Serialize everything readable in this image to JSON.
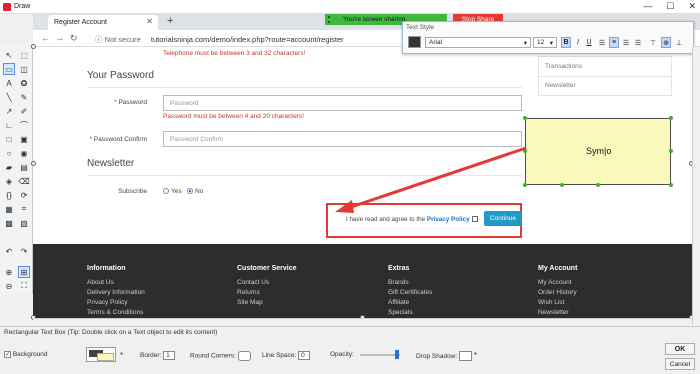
{
  "app": {
    "title": "Draw",
    "min": "—",
    "max": "☐",
    "close": "✕"
  },
  "browser": {
    "tab_title": "Register Account",
    "tab_close": "✕",
    "new_tab": "+",
    "share_text": "You're screen sharing",
    "stop_share": "Stop Share",
    "not_secure": "ⓘ Not secure",
    "url": "tutorialsninja.com/demo/index.php?route=account/register"
  },
  "form": {
    "telephone_error": "Telephone must be between 3 and 32 characters!",
    "password_section": "Your Password",
    "password_label": "Password",
    "password_placeholder": "Password",
    "password_error": "Password must be between 4 and 20 characters!",
    "confirm_label": "Password Confirm",
    "confirm_placeholder": "Password Confirm",
    "newsletter_section": "Newsletter",
    "subscribe_label": "Subscribe",
    "radio_yes": "Yes",
    "radio_no": "No",
    "subscribe_value": "No",
    "agree_text": "I have read and agree to the ",
    "privacy_link": "Privacy Policy",
    "continue": "Continue"
  },
  "right_menu": [
    "Transactions",
    "Newsletter"
  ],
  "footer": {
    "columns": [
      {
        "head": "Information",
        "items": [
          "About Us",
          "Delivery Information",
          "Privacy Policy",
          "Terms & Conditions"
        ]
      },
      {
        "head": "Customer Service",
        "items": [
          "Contact Us",
          "Returns",
          "Site Map"
        ]
      },
      {
        "head": "Extras",
        "items": [
          "Brands",
          "Gift Certificates",
          "Affiliate",
          "Specials"
        ]
      },
      {
        "head": "My Account",
        "items": [
          "My Account",
          "Order History",
          "Wish List",
          "Newsletter"
        ]
      }
    ]
  },
  "text_style": {
    "title": "Text Style",
    "font": "Arial",
    "size": "12",
    "bold": "B",
    "italic": "I",
    "underline": "U"
  },
  "note": {
    "text": "Sym|o"
  },
  "status_hint": "Rectangular Text Box (Tip: Double click on a Text object to edit its content)",
  "props": {
    "background_label": "Background",
    "border_label": "Border:",
    "border_value": "1",
    "round_label": "Round Corners:",
    "linespace_label": "Line Space:",
    "linespace_value": "0",
    "opacity_label": "Opacity:",
    "shadow_label": "Drop Shadow:",
    "ok": "OK",
    "cancel": "Cancel"
  },
  "colors": {
    "accent": "#229ac8",
    "annotation": "#e53935",
    "note_bg": "#fbf8bb",
    "share": "#3fb83f"
  }
}
